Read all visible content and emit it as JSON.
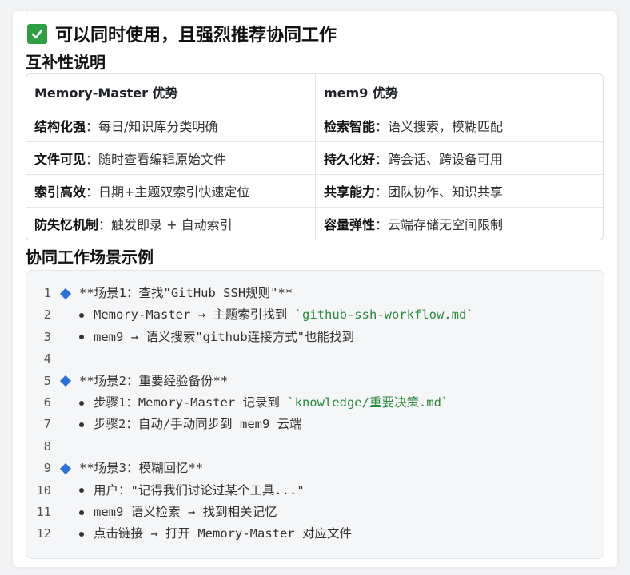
{
  "heading": {
    "check_icon": "white-check-mark-icon",
    "check_color": "#2ea043",
    "text": "可以同时使用，且强烈推荐协同工作"
  },
  "complement": {
    "title": "互补性说明",
    "headers": [
      "Memory-Master 优势",
      "mem9 优势"
    ],
    "rows": [
      {
        "left_term": "结构化强",
        "left_desc": "：每日/知识库分类明确",
        "right_term": "检索智能",
        "right_desc": "：语义搜索，模糊匹配"
      },
      {
        "left_term": "文件可见",
        "left_desc": "：随时查看编辑原始文件",
        "right_term": "持久化好",
        "right_desc": "：跨会话、跨设备可用"
      },
      {
        "left_term": "索引高效",
        "left_desc": "：日期+主题双索引快速定位",
        "right_term": "共享能力",
        "right_desc": "：团队协作、知识共享"
      },
      {
        "left_term": "防失忆机制",
        "left_desc": "：触发即录 + 自动索引",
        "right_term": "容量弹性",
        "right_desc": "：云端存储无空间限制"
      }
    ]
  },
  "scenarios": {
    "title": "协同工作场景示例",
    "lines": [
      {
        "n": "1",
        "type": "heading",
        "parts": [
          {
            "t": "**场景1：查找\"GitHub SSH规则\"**"
          }
        ]
      },
      {
        "n": "2",
        "type": "bullet",
        "parts": [
          {
            "t": "Memory-Master → 主题索引找到 "
          },
          {
            "t": "`github-ssh-workflow.md`",
            "green": true
          }
        ]
      },
      {
        "n": "3",
        "type": "bullet",
        "parts": [
          {
            "t": "mem9 → 语义搜索\"github连接方式\"也能找到"
          }
        ]
      },
      {
        "n": "4",
        "type": "empty",
        "parts": []
      },
      {
        "n": "5",
        "type": "heading",
        "parts": [
          {
            "t": "**场景2：重要经验备份**"
          }
        ]
      },
      {
        "n": "6",
        "type": "bullet",
        "parts": [
          {
            "t": "步骤1：Memory-Master 记录到 "
          },
          {
            "t": "`knowledge/重要决策.md`",
            "green": true
          }
        ]
      },
      {
        "n": "7",
        "type": "bullet",
        "parts": [
          {
            "t": "步骤2：自动/手动同步到 mem9 云端"
          }
        ]
      },
      {
        "n": "8",
        "type": "empty",
        "parts": []
      },
      {
        "n": "9",
        "type": "heading",
        "parts": [
          {
            "t": "**场景3：模糊回忆**"
          }
        ]
      },
      {
        "n": "10",
        "type": "bullet",
        "parts": [
          {
            "t": "用户：\"记得我们讨论过某个工具...\""
          }
        ]
      },
      {
        "n": "11",
        "type": "bullet",
        "parts": [
          {
            "t": "mem9 语义检索 → 找到相关记忆"
          }
        ]
      },
      {
        "n": "12",
        "type": "bullet",
        "parts": [
          {
            "t": "点击链接 → 打开 Memory-Master 对应文件"
          }
        ]
      }
    ],
    "diamond_icon": "small-blue-diamond-icon",
    "diamond_color": "#2f6fd6"
  }
}
